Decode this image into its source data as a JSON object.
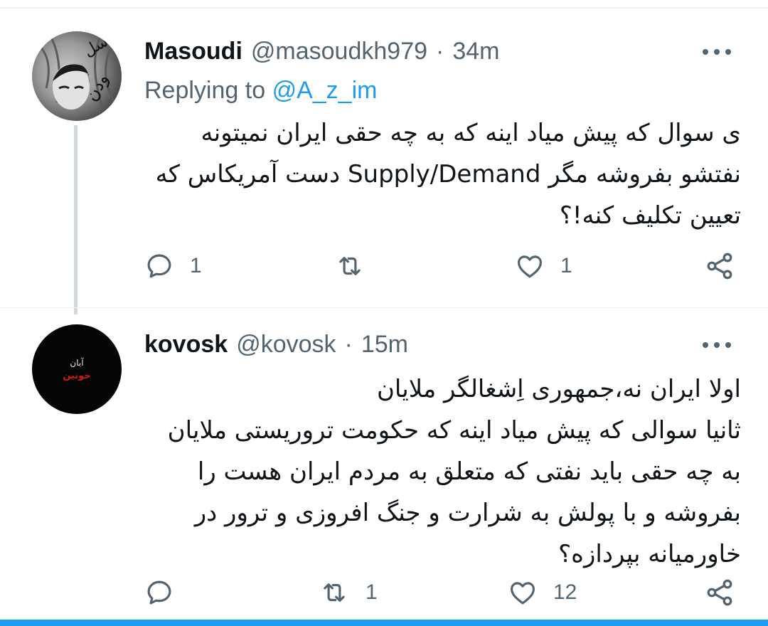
{
  "tweets": [
    {
      "display_name": "Masoudi",
      "handle": "@masoudkh979",
      "separator": "·",
      "time": "34m",
      "replying_prefix": "Replying to",
      "replying_mention": "@A_z_im",
      "body_lines": [
        "ی سوال که پیش میاد اینه که به چه حقی ایران نمیتونه",
        "نفتشو بفروشه مگر Supply/Demand دست آمریکاس که",
        "تعیین تکلیف کنه!؟"
      ],
      "reply_count": "1",
      "retweet_count": "",
      "like_count": "1",
      "avatar_text": "س ل و د ن"
    },
    {
      "display_name": "kovosk",
      "handle": "@kovosk",
      "separator": "·",
      "time": "15m",
      "body_lines": [
        "اولا ایران نه،جمهوری اِشغالگر ملایان",
        "ثانیا سوالی که پیش میاد اینه که حکومت تروریستی ملایان",
        "به چه حقی باید نفتی که متعلق به مردم ایران هست را",
        "بفروشه و با پولش به شرارت و جنگ افروزی و ترور در",
        "خاورمیانه بپردازه؟"
      ],
      "reply_count": "",
      "retweet_count": "1",
      "like_count": "12",
      "avatar_text_1": "آبان",
      "avatar_text_2": "خونین"
    }
  ],
  "icons": {
    "reply": "reply-icon",
    "retweet": "retweet-icon",
    "like": "heart-icon",
    "share": "share-icon",
    "more": "more-icon"
  },
  "colors": {
    "text": "#0f1419",
    "secondary": "#536471",
    "accent": "#1d9bf0",
    "thread_line": "#cfd9de"
  }
}
